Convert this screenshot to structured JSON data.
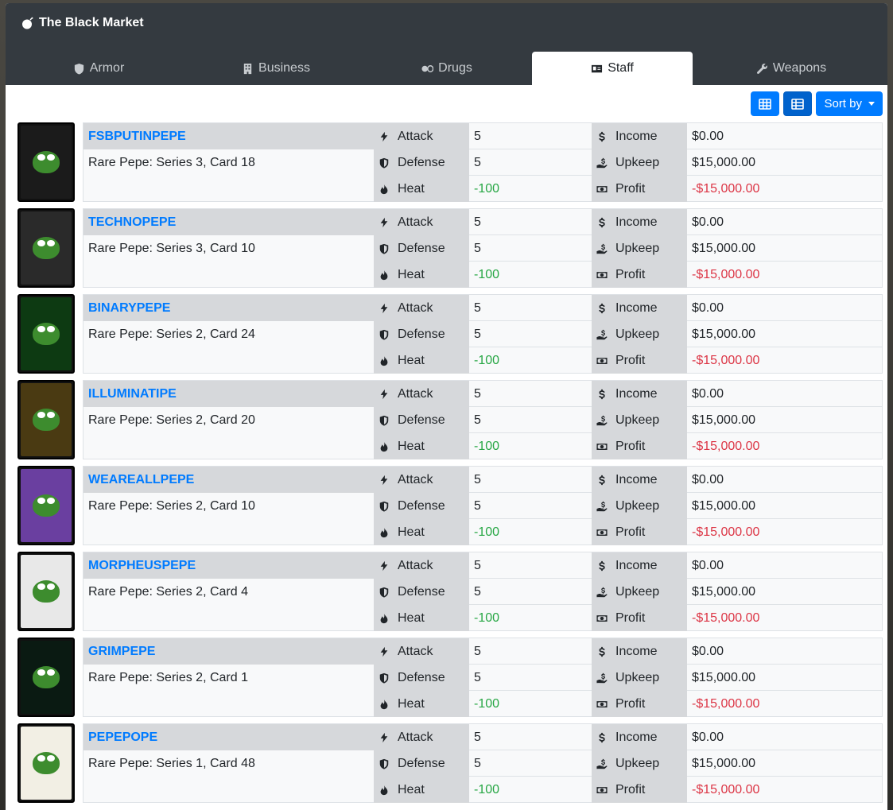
{
  "app": {
    "title": "The Black Market"
  },
  "tabs": [
    {
      "label": "Armor",
      "icon": "shield-icon"
    },
    {
      "label": "Business",
      "icon": "building-icon"
    },
    {
      "label": "Drugs",
      "icon": "pills-icon"
    },
    {
      "label": "Staff",
      "icon": "id-card-icon",
      "active": true
    },
    {
      "label": "Weapons",
      "icon": "wrench-icon"
    }
  ],
  "toolbar": {
    "sort_label": "Sort by"
  },
  "labels": {
    "attack": "Attack",
    "defense": "Defense",
    "heat": "Heat",
    "income": "Income",
    "upkeep": "Upkeep",
    "profit": "Profit"
  },
  "colors": {
    "accent": "#007bff",
    "positive": "#28a745",
    "negative": "#dc3545"
  },
  "items": [
    {
      "name": "FSBPUTINPEPE",
      "subtitle": "Rare Pepe: Series 3, Card 18",
      "attack": "5",
      "defense": "5",
      "heat": "-100",
      "income": "$0.00",
      "upkeep": "$15,000.00",
      "profit": "-$15,000.00",
      "card_color": "#1b1b1b"
    },
    {
      "name": "TECHNOPEPE",
      "subtitle": "Rare Pepe: Series 3, Card 10",
      "attack": "5",
      "defense": "5",
      "heat": "-100",
      "income": "$0.00",
      "upkeep": "$15,000.00",
      "profit": "-$15,000.00",
      "card_color": "#2a2a2a"
    },
    {
      "name": "BINARYPEPE",
      "subtitle": "Rare Pepe: Series 2, Card 24",
      "attack": "5",
      "defense": "5",
      "heat": "-100",
      "income": "$0.00",
      "upkeep": "$15,000.00",
      "profit": "-$15,000.00",
      "card_color": "#0d3a12"
    },
    {
      "name": "ILLUMINATIPE",
      "subtitle": "Rare Pepe: Series 2, Card 20",
      "attack": "5",
      "defense": "5",
      "heat": "-100",
      "income": "$0.00",
      "upkeep": "$15,000.00",
      "profit": "-$15,000.00",
      "card_color": "#4a3a12"
    },
    {
      "name": "WEAREALLPEPE",
      "subtitle": "Rare Pepe: Series 2, Card 10",
      "attack": "5",
      "defense": "5",
      "heat": "-100",
      "income": "$0.00",
      "upkeep": "$15,000.00",
      "profit": "-$15,000.00",
      "card_color": "#6a3fa0"
    },
    {
      "name": "MORPHEUSPEPE",
      "subtitle": "Rare Pepe: Series 2, Card 4",
      "attack": "5",
      "defense": "5",
      "heat": "-100",
      "income": "$0.00",
      "upkeep": "$15,000.00",
      "profit": "-$15,000.00",
      "card_color": "#e8e8e8"
    },
    {
      "name": "GRIMPEPE",
      "subtitle": "Rare Pepe: Series 2, Card 1",
      "attack": "5",
      "defense": "5",
      "heat": "-100",
      "income": "$0.00",
      "upkeep": "$15,000.00",
      "profit": "-$15,000.00",
      "card_color": "#0a1a12"
    },
    {
      "name": "PEPEPOPE",
      "subtitle": "Rare Pepe: Series 1, Card 48",
      "attack": "5",
      "defense": "5",
      "heat": "-100",
      "income": "$0.00",
      "upkeep": "$15,000.00",
      "profit": "-$15,000.00",
      "card_color": "#f2efe4"
    }
  ]
}
